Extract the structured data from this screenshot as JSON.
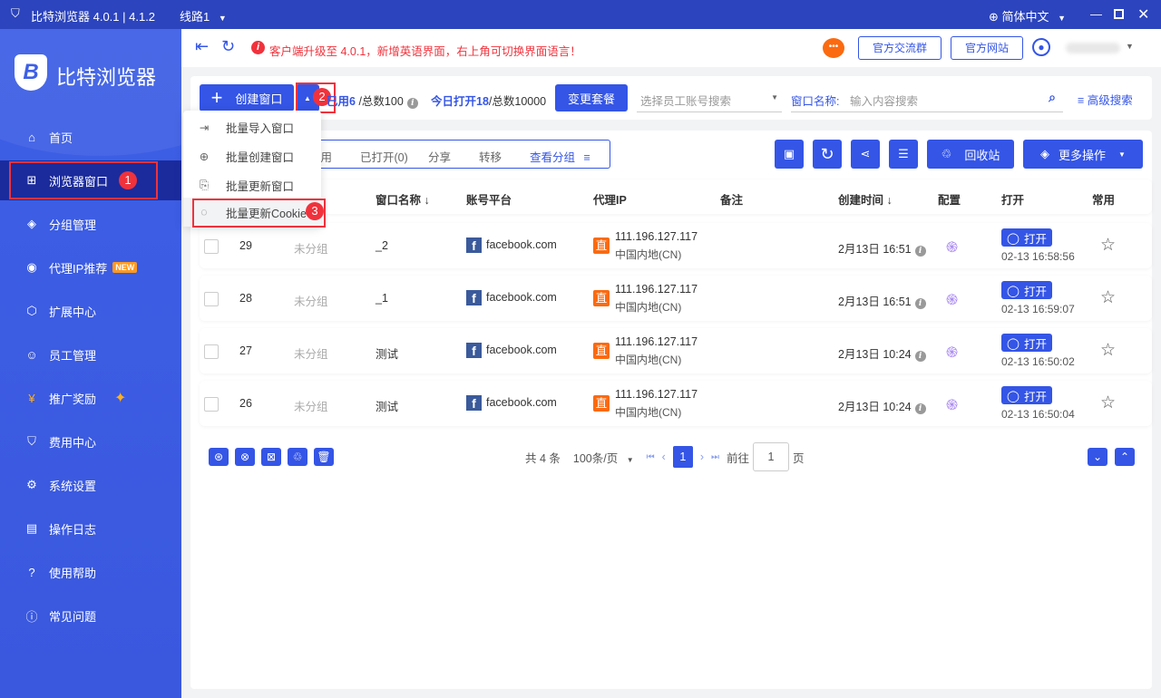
{
  "titlebar": {
    "title": "比特浏览器 4.0.1 | 4.1.2",
    "line": "线路1",
    "language": "简体中文"
  },
  "sidebar": {
    "brand": "比特浏览器",
    "items": [
      {
        "label": "首页",
        "icon": "home-icon"
      },
      {
        "label": "浏览器窗口",
        "icon": "grid-icon",
        "badge": "1"
      },
      {
        "label": "分组管理",
        "icon": "layers-icon"
      },
      {
        "label": "代理IP推荐",
        "icon": "location-icon",
        "tag": "NEW"
      },
      {
        "label": "扩展中心",
        "icon": "cube-icon"
      },
      {
        "label": "员工管理",
        "icon": "users-icon"
      },
      {
        "label": "推广奖励",
        "icon": "yen-icon"
      },
      {
        "label": "费用中心",
        "icon": "shield-icon"
      },
      {
        "label": "系统设置",
        "icon": "gear-icon"
      },
      {
        "label": "操作日志",
        "icon": "log-icon"
      },
      {
        "label": "使用帮助",
        "icon": "help-icon"
      },
      {
        "label": "常见问题",
        "icon": "info-icon"
      }
    ]
  },
  "header": {
    "notice": "客户端升级至 4.0.1，新增英语界面，右上角可切换界面语言！",
    "community": "官方交流群",
    "website": "官方网站"
  },
  "toolbar": {
    "create": "创建窗口",
    "dropdown_badge": "2",
    "used_label": "已用6",
    "total_label": "/总数100",
    "today_label": "今日打开18",
    "today_total": "/总数10000",
    "change_plan": "变更套餐",
    "staff_placeholder": "选择员工账号搜索",
    "name_label": "窗口名称:",
    "name_placeholder": "输入内容搜索",
    "advanced": "高级搜索"
  },
  "menu": {
    "items": [
      "批量导入窗口",
      "批量创建窗口",
      "批量更新窗口",
      "批量更新Cookie"
    ],
    "badge": "3"
  },
  "tabs": [
    "常用",
    "已打开(0)",
    "分享",
    "转移",
    "查看分组"
  ],
  "actions": {
    "recycle": "回收站",
    "more": "更多操作"
  },
  "columns": [
    "窗口名称 ↓",
    "账号平台",
    "代理IP",
    "备注",
    "创建时间 ↓",
    "配置",
    "打开",
    "常用"
  ],
  "rows": [
    {
      "id": "29",
      "group": "未分组",
      "name": "_2",
      "platform": "facebook.com",
      "ip": "111.196.127.117",
      "region": "中国内地(CN)",
      "created": "2月13日 16:51",
      "open": "打开",
      "opened": "02-13 16:58:56"
    },
    {
      "id": "28",
      "group": "未分组",
      "name": "_1",
      "platform": "facebook.com",
      "ip": "111.196.127.117",
      "region": "中国内地(CN)",
      "created": "2月13日 16:51",
      "open": "打开",
      "opened": "02-13 16:59:07"
    },
    {
      "id": "27",
      "group": "未分组",
      "name": "测试",
      "platform": "facebook.com",
      "ip": "111.196.127.117",
      "region": "中国内地(CN)",
      "created": "2月13日 10:24",
      "open": "打开",
      "opened": "02-13 16:50:02"
    },
    {
      "id": "26",
      "group": "未分组",
      "name": "测试",
      "platform": "facebook.com",
      "ip": "111.196.127.117",
      "region": "中国内地(CN)",
      "created": "2月13日 10:24",
      "open": "打开",
      "opened": "02-13 16:50:04"
    }
  ],
  "proxy_tag": "直",
  "pagination": {
    "total": "共 4 条",
    "page_size": "100条/页",
    "current": "1",
    "goto_label": "前往",
    "goto_value": "1",
    "page_suffix": "页"
  }
}
